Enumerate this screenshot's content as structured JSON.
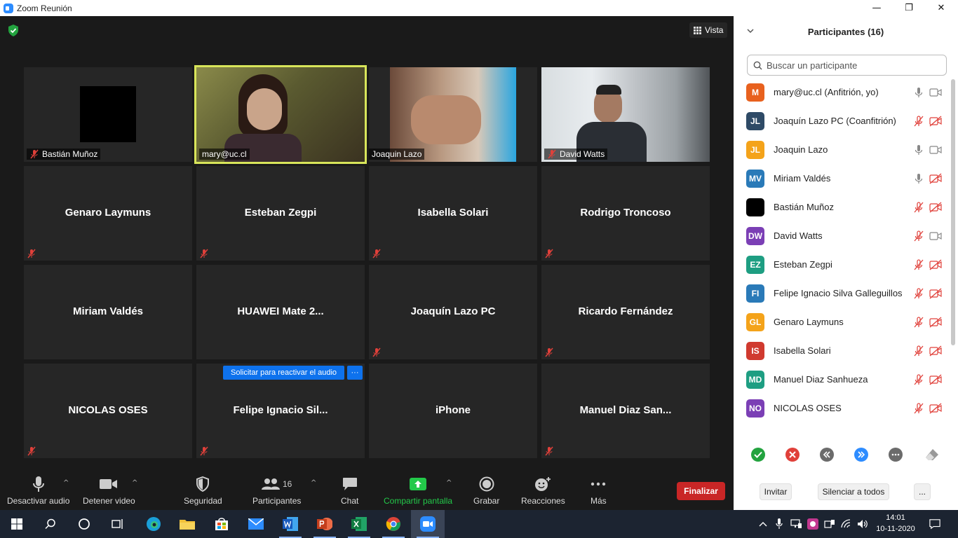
{
  "window": {
    "title": "Zoom Reunión",
    "minimize": "—",
    "maximize": "❐",
    "close": "✕"
  },
  "video": {
    "view_label": "Vista",
    "tiles": [
      {
        "name": "Bastián Muñoz",
        "type": "video-tag",
        "muted": true
      },
      {
        "name": "mary@uc.cl",
        "type": "video-tag",
        "muted": false,
        "active": true
      },
      {
        "name": "Joaquin Lazo",
        "type": "video-tag",
        "muted": false
      },
      {
        "name": "David Watts",
        "type": "video-tag",
        "muted": true
      },
      {
        "name": "Genaro Laymuns",
        "type": "name",
        "muted": true
      },
      {
        "name": "Esteban Zegpi",
        "type": "name",
        "muted": true
      },
      {
        "name": "Isabella Solari",
        "type": "name",
        "muted": true
      },
      {
        "name": "Rodrigo Troncoso",
        "type": "name",
        "muted": true
      },
      {
        "name": "Miriam Valdés",
        "type": "name",
        "muted": false
      },
      {
        "name": "HUAWEI Mate 2...",
        "type": "name",
        "muted": false
      },
      {
        "name": "Joaquín Lazo PC",
        "type": "name",
        "muted": true
      },
      {
        "name": "Ricardo Fernández",
        "type": "name",
        "muted": true
      },
      {
        "name": "NICOLAS OSES",
        "type": "name",
        "muted": true
      },
      {
        "name": "Felipe  Ignacio  Sil...",
        "type": "name",
        "muted": true
      },
      {
        "name": "iPhone",
        "type": "name",
        "muted": false
      },
      {
        "name": "Manuel  Diaz  San...",
        "type": "name",
        "muted": true
      }
    ],
    "request_audio_label": "Solicitar para reactivar el audio",
    "request_more_label": "···"
  },
  "toolbar": {
    "mute_label": "Desactivar audio",
    "video_label": "Detener video",
    "security_label": "Seguridad",
    "participants_label": "Participantes",
    "participants_count": "16",
    "chat_label": "Chat",
    "share_label": "Compartir pantalla",
    "record_label": "Grabar",
    "reactions_label": "Reacciones",
    "more_label": "Más",
    "end_label": "Finalizar",
    "caret": "^"
  },
  "panel": {
    "title": "Participantes (16)",
    "search_placeholder": "Buscar un participante",
    "participants": [
      {
        "initials": "M",
        "color": "#e8611e",
        "name": "mary@uc.cl (Anfitrión, yo)",
        "mic": "on",
        "cam": "on"
      },
      {
        "initials": "JL",
        "color": "#2e4a66",
        "name": "Joaquín Lazo PC (Coanfitrión)",
        "mic": "off",
        "cam": "off"
      },
      {
        "initials": "JL",
        "color": "#f4a31a",
        "name": "Joaquin Lazo",
        "mic": "on",
        "cam": "on"
      },
      {
        "initials": "MV",
        "color": "#2a7ab8",
        "name": "Miriam Valdés",
        "mic": "on",
        "cam": "off"
      },
      {
        "initials": "",
        "color": "#000000",
        "name": "Bastián Muñoz",
        "mic": "off",
        "cam": "off"
      },
      {
        "initials": "DW",
        "color": "#7b3fb5",
        "name": "David Watts",
        "mic": "off",
        "cam": "on"
      },
      {
        "initials": "EZ",
        "color": "#1e9e82",
        "name": "Esteban Zegpi",
        "mic": "off",
        "cam": "off"
      },
      {
        "initials": "FI",
        "color": "#2a7ab8",
        "name": "Felipe Ignacio Silva Galleguillos",
        "mic": "off",
        "cam": "off"
      },
      {
        "initials": "GL",
        "color": "#f4a31a",
        "name": "Genaro Laymuns",
        "mic": "off",
        "cam": "off"
      },
      {
        "initials": "IS",
        "color": "#d03a2f",
        "name": "Isabella Solari",
        "mic": "off",
        "cam": "off"
      },
      {
        "initials": "MD",
        "color": "#1e9e82",
        "name": "Manuel Diaz Sanhueza",
        "mic": "off",
        "cam": "off"
      },
      {
        "initials": "NO",
        "color": "#7b3fb5",
        "name": "NICOLAS OSES",
        "mic": "off",
        "cam": "off"
      }
    ],
    "invite_label": "Invitar",
    "mute_all_label": "Silenciar a todos",
    "more_label": "...",
    "colors": {
      "green": "#23a33f",
      "red": "#e0403a",
      "gray": "#6b6b6b",
      "blue": "#2d8cff"
    }
  },
  "taskbar": {
    "time": "14:01",
    "date": "10-11-2020"
  }
}
